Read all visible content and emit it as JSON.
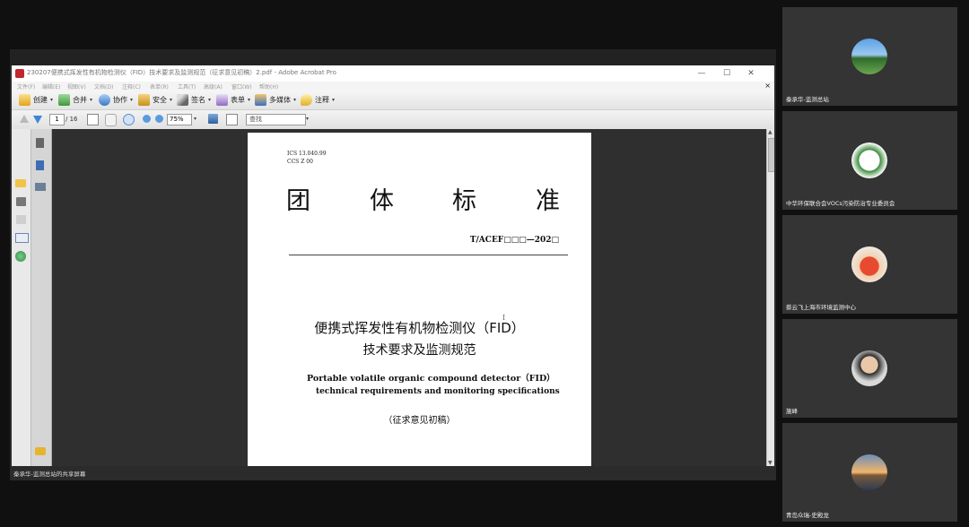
{
  "window": {
    "title": "230207便携式挥发性有机物检测仪（FID）技术要求及监测规范（征求意见初稿）2.pdf - Adobe Acrobat Pro",
    "minimize_icon": "—",
    "maximize_icon": "☐",
    "close_icon": "✕"
  },
  "menu": [
    "文件(F)",
    "编辑(E)",
    "视图(V)",
    "文档(D)",
    "注释(C)",
    "表单(R)",
    "工具(T)",
    "高级(A)",
    "窗口(W)",
    "帮助(H)"
  ],
  "menu_doc_close": "×",
  "toolbar": {
    "create": "创建",
    "combine": "合并",
    "collaborate": "协作",
    "secure": "安全",
    "sign": "签名",
    "forms": "表单",
    "multimedia": "多媒体",
    "comment": "注释",
    "dropdown": "▾"
  },
  "nav": {
    "page_current": "1",
    "page_total": "/ 16",
    "zoom": "75%",
    "find_placeholder": "查找",
    "find_caret": "▾",
    "zoom_caret": "▾"
  },
  "document": {
    "ics": "ICS 13.040.99",
    "ccs": "CCS Z 00",
    "type_chars": [
      "团",
      "体",
      "标",
      "准"
    ],
    "standard_no": "T/ACEF□□□—202□",
    "title_cn_line1": "便携式挥发性有机物检测仪（FID）",
    "title_cn_line2": "技术要求及监测规范",
    "title_en_line1": "Portable volatile organic compound detector（FID）",
    "title_en_line2": "technical requirements and monitoring specifications",
    "draft_note": "（征求意见初稿）",
    "cursor_glyph": "I"
  },
  "scrollbar": {
    "up": "▲",
    "down": "▼"
  },
  "share_label": "秦承华-监测总站的共享屏幕",
  "participants": [
    {
      "name": "秦承华-监测总站"
    },
    {
      "name": "中华环保联合会VOCs污染防治专业委员会"
    },
    {
      "name": "蔡云飞上海市环境监测中心"
    },
    {
      "name": "施峰"
    },
    {
      "name": "青岛众瑞-史殿龙"
    }
  ],
  "colors": {
    "desktop_bg": "#101010",
    "doc_area_bg": "#2f2f2f",
    "tile_bg": "#343434",
    "acrobat_red": "#c1272d"
  }
}
